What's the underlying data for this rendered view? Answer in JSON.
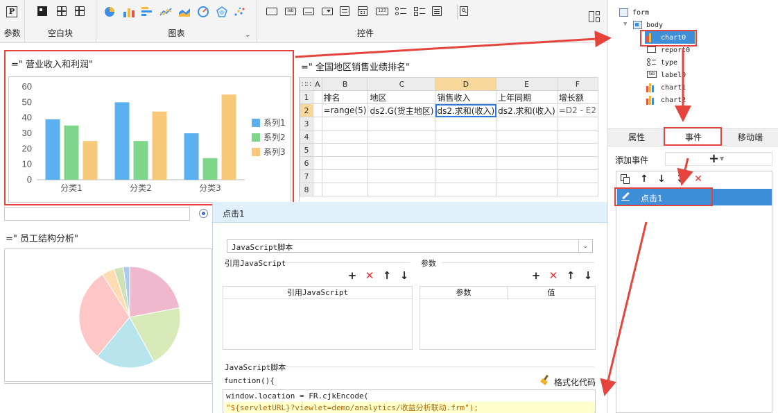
{
  "toolbar": {
    "groups": [
      {
        "label": "参数"
      },
      {
        "label": "空白块"
      },
      {
        "label": "图表"
      },
      {
        "label": "控件"
      }
    ],
    "param_icon": "P"
  },
  "canvas": {
    "chart0_title": "=\"  营业收入和利润\"",
    "report_title": "=\"  全国地区销售业绩排名\"",
    "chart1_title": "=\"  员工结构分析\""
  },
  "chart_data": {
    "type": "bar",
    "title": "",
    "categories": [
      "分类1",
      "分类2",
      "分类3"
    ],
    "series": [
      {
        "name": "系列1",
        "values": [
          39,
          50,
          30
        ],
        "color": "#5bb0f0"
      },
      {
        "name": "系列2",
        "values": [
          35,
          25,
          14
        ],
        "color": "#7ed68a"
      },
      {
        "name": "系列3",
        "values": [
          25,
          44,
          55
        ],
        "color": "#f8c879"
      }
    ],
    "ylim": [
      0,
      60
    ],
    "yticks": [
      0,
      10,
      20,
      30,
      40,
      50,
      60
    ],
    "legend": "right",
    "grid": false
  },
  "pie_data": {
    "type": "pie",
    "slices": [
      {
        "value": 22,
        "color": "#efb8cc"
      },
      {
        "value": 20,
        "color": "#d8eab8"
      },
      {
        "value": 19,
        "color": "#b8e4ee"
      },
      {
        "value": 30,
        "color": "#ffc6c6"
      },
      {
        "value": 4,
        "color": "#ffdcb2"
      },
      {
        "value": 3,
        "color": "#cfe2b6"
      },
      {
        "value": 2,
        "color": "#a9cdf0"
      }
    ]
  },
  "report": {
    "columns": [
      "A",
      "B",
      "C",
      "D",
      "E",
      "F"
    ],
    "rows": [
      [
        "",
        "排名",
        "地区",
        "销售收入",
        "上年同期",
        "增长额"
      ],
      [
        "",
        "=range(5)",
        "ds2.G(货主地区)",
        "ds2.求和(收入)",
        "ds2.求和(收入)",
        "=D2 - E2"
      ],
      [
        "",
        "",
        "",
        "",
        "",
        ""
      ],
      [
        "",
        "",
        "",
        "",
        "",
        ""
      ],
      [
        "",
        "",
        "",
        "",
        "",
        ""
      ],
      [
        "",
        "",
        "",
        "",
        "",
        ""
      ],
      [
        "",
        "",
        "",
        "",
        "",
        ""
      ],
      [
        "",
        "",
        "",
        "",
        "",
        ""
      ]
    ],
    "row_numbers": [
      "1",
      "2",
      "3",
      "4",
      "5",
      "6",
      "7",
      "8"
    ],
    "selected_col": "D",
    "selected_row": "2"
  },
  "dialog": {
    "title": "点击1",
    "script_type": "JavaScript脚本",
    "ref_js_label": "引用JavaScript",
    "params_label": "参数",
    "ref_js_col": "引用JavaScript",
    "param_col": "参数",
    "value_col": "值",
    "js_label": "JavaScript脚本",
    "format_label": "格式化代码",
    "func_sig": "function(){",
    "code_line1": "window.location = FR.cjkEncode(",
    "code_line2": "\"${servletURL}?viewlet=demo/analytics/收益分析联动.frm\");"
  },
  "tree": {
    "items": [
      "form",
      "body",
      "chart0",
      "report0",
      "type",
      "label0",
      "chart1",
      "chart2"
    ]
  },
  "panel": {
    "tabs": [
      "属性",
      "事件",
      "移动端"
    ],
    "add_event_label": "添加事件",
    "add_symbol": "+",
    "event_item": "点击1"
  }
}
